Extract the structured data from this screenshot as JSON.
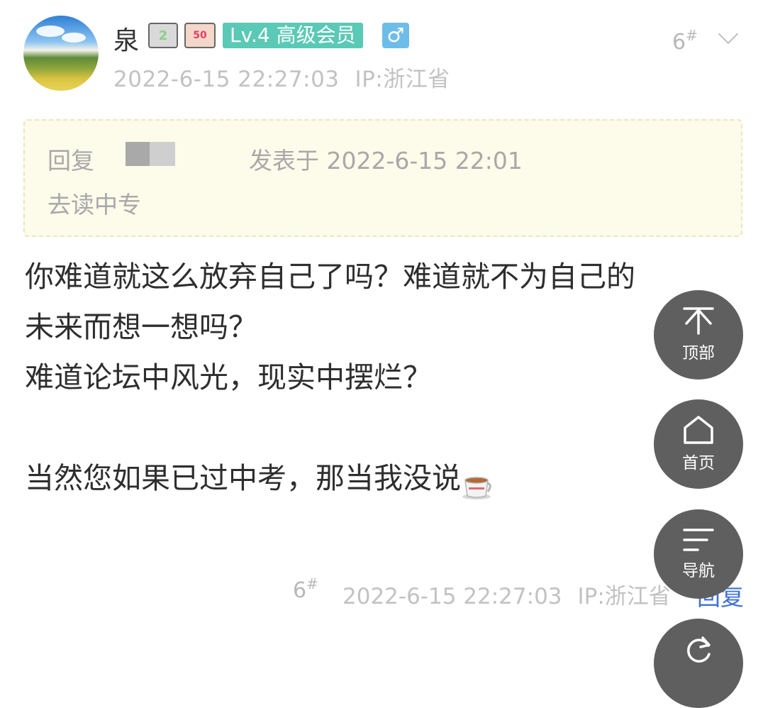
{
  "post": {
    "user": {
      "name": "泉",
      "badge1": "2",
      "badge2": "50",
      "level": "Lv.4 高级会员",
      "gender": "♂"
    },
    "timestamp": "2022-6-15 22:27:03",
    "ip": "IP:浙江省",
    "floor": "6",
    "floor_mark": "#",
    "quote": {
      "prefix": "回复",
      "date": "发表于 2022-6-15 22:01",
      "text": "去读中专"
    },
    "content": {
      "line1": "你难道就这么放弃自己了吗？难道就不为自己的",
      "line2": "未来而想一想吗？",
      "line3": "难道论坛中风光，现实中摆烂？",
      "line4": "当然您如果已过中考，那当我没说"
    },
    "footer": {
      "floor": "6",
      "floor_mark": "#",
      "timestamp": "2022-6-15 22:27:03",
      "ip": "IP:浙江省",
      "reply": "回复"
    }
  },
  "fabs": {
    "top_label": "顶部",
    "home_label": "首页",
    "nav_label": "导航"
  },
  "icons": [
    "chevron-down-icon",
    "arrow-to-top-icon",
    "home-icon",
    "menu-lines-icon",
    "refresh-icon",
    "tea-cup-emoji-icon"
  ],
  "colors": {
    "level_badge": "#5ac9b5",
    "gender_badge": "#6ebde9",
    "quote_bg": "#fdfbea",
    "reply_link": "#3f71d6",
    "fab_bg": "#5f5f5f"
  }
}
